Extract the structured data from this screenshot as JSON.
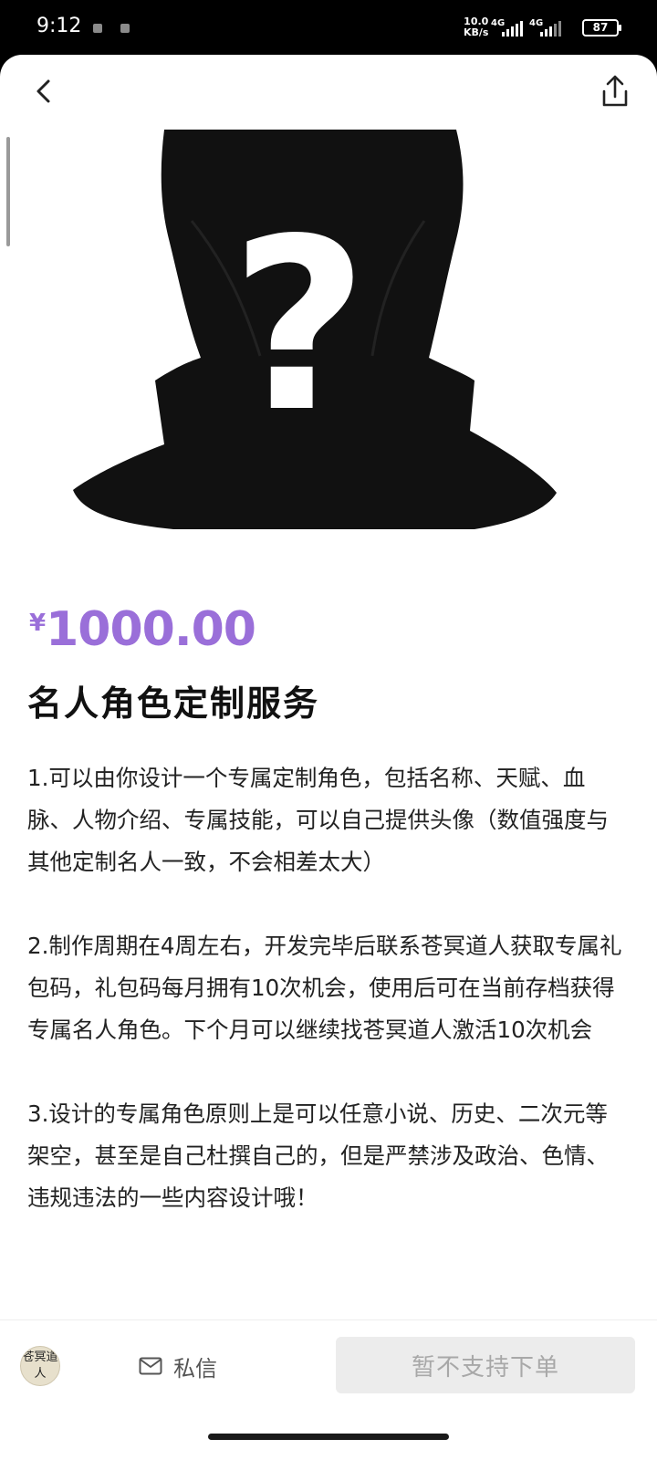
{
  "status_bar": {
    "time": "9:12",
    "net_speed_value": "10.0",
    "net_speed_unit": "KB/s",
    "signal1_label": "4G",
    "signal2_label": "4G",
    "battery": "87"
  },
  "nav": {
    "back_icon": "chevron-left-icon",
    "share_icon": "share-icon"
  },
  "product": {
    "price_symbol": "¥",
    "price": "1000.00",
    "title": "名人角色定制服务",
    "description": [
      "1.可以由你设计一个专属定制角色，包括名称、天赋、血脉、人物介绍、专属技能，可以自己提供头像（数值强度与其他定制名人一致，不会相差太大）",
      "2.制作周期在4周左右，开发完毕后联系苍冥道人获取专属礼包码，礼包码每月拥有10次机会，使用后可在当前存档获得专属名人角色。下个月可以继续找苍冥道人激活10次机会",
      "3.设计的专属角色原则上是可以任意小说、历史、二次元等架空，甚至是自己杜撰自己的，但是严禁涉及政治、色情、违规违法的一些内容设计哦！"
    ]
  },
  "bottom_bar": {
    "seller_avatar_text": "苍冥道人",
    "dm_label": "私信",
    "order_label": "暂不支持下单"
  },
  "colors": {
    "price": "#9a6fd9",
    "disabled_button_bg": "#ececec",
    "disabled_button_text": "#a8a8a8"
  }
}
